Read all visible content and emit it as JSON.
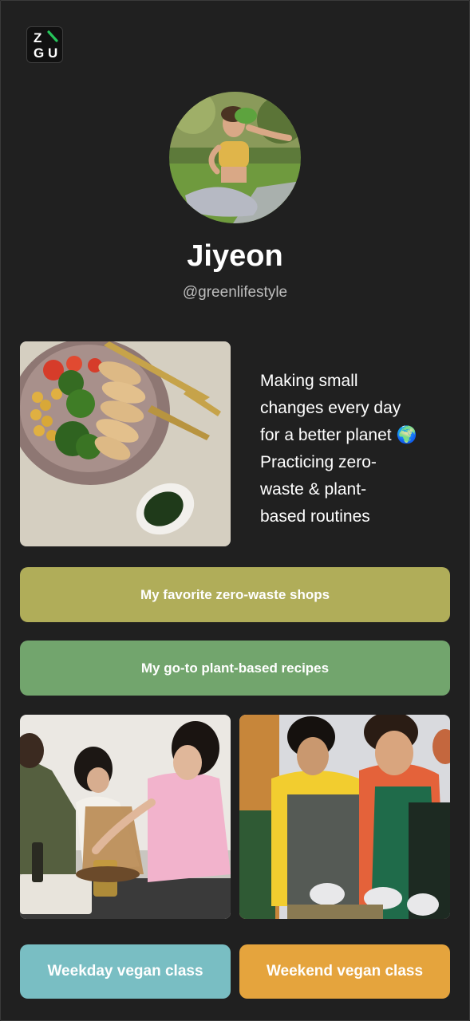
{
  "logo": {
    "letters": [
      "Z",
      "G",
      "U"
    ],
    "accent": "#25c45a"
  },
  "profile": {
    "name": "Jiyeon",
    "handle": "@greenlifestyle",
    "avatar_icon": "profile-photo"
  },
  "bio": {
    "lines": [
      "Making small",
      "changes every day",
      "for a better planet 🌍",
      "Practicing zero-",
      "waste & plant-",
      "based routines"
    ]
  },
  "links": [
    {
      "label": "My favorite zero-waste shops",
      "color": "#b0ad59"
    },
    {
      "label": "My go-to plant-based recipes",
      "color": "#72a56d"
    }
  ],
  "classes": [
    {
      "label": "Weekday vegan class",
      "color": "#79bec3"
    },
    {
      "label": "Weekend vegan class",
      "color": "#e5a43d"
    }
  ],
  "colors": {
    "background": "#202020",
    "handle": "#bdbdbd"
  }
}
